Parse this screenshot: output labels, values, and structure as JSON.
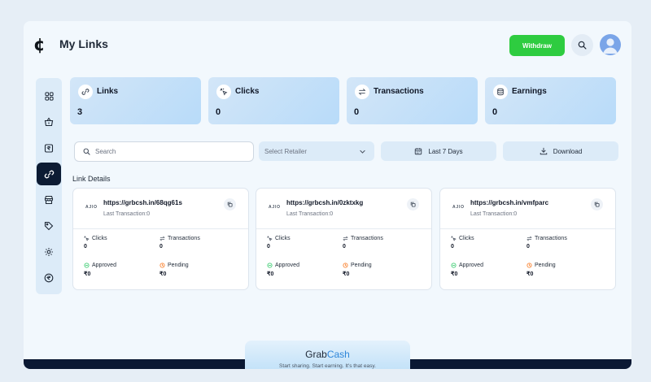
{
  "header": {
    "logo_glyph": "¢",
    "title": "My Links",
    "withdraw_label": "Withdraw"
  },
  "colors": {
    "accent_green": "#2ecc40",
    "navy": "#0c1b33",
    "pending_orange": "#f97316",
    "approved_green": "#22c55e",
    "link_blue": "#2f86d9"
  },
  "sidebar": {
    "items": [
      {
        "icon": "grid-icon"
      },
      {
        "icon": "basket-icon"
      },
      {
        "icon": "rupee-box-icon"
      },
      {
        "icon": "link-icon",
        "active": true
      },
      {
        "icon": "store-icon"
      },
      {
        "icon": "tag-icon"
      },
      {
        "icon": "gear-icon"
      },
      {
        "icon": "rupee-circle-icon"
      }
    ]
  },
  "stats": [
    {
      "label": "Links",
      "value": "3",
      "icon": "link-icon"
    },
    {
      "label": "Clicks",
      "value": "0",
      "icon": "click-icon"
    },
    {
      "label": "Transactions",
      "value": "0",
      "icon": "exchange-icon"
    },
    {
      "label": "Earnings",
      "value": "0",
      "icon": "coins-icon"
    }
  ],
  "filters": {
    "search_placeholder": "Search",
    "retailer_placeholder": "Select Retailer",
    "date_label": "Last 7 Days",
    "download_label": "Download"
  },
  "section_title": "Link Details",
  "cards": [
    {
      "retailer": "AJIO",
      "url": "https://grbcsh.in/68qg61s",
      "last_transaction": "Last Transaction:0",
      "clicks_label": "Clicks",
      "clicks": "0",
      "transactions_label": "Transactions",
      "transactions": "0",
      "approved_label": "Approved",
      "approved": "₹0",
      "pending_label": "Pending",
      "pending": "₹0"
    },
    {
      "retailer": "AJIO",
      "url": "https://grbcsh.in/0zktxkg",
      "last_transaction": "Last Transaction:0",
      "clicks_label": "Clicks",
      "clicks": "0",
      "transactions_label": "Transactions",
      "transactions": "0",
      "approved_label": "Approved",
      "approved": "₹0",
      "pending_label": "Pending",
      "pending": "₹0"
    },
    {
      "retailer": "AJIO",
      "url": "https://grbcsh.in/vmfparc",
      "last_transaction": "Last Transaction:0",
      "clicks_label": "Clicks",
      "clicks": "0",
      "transactions_label": "Transactions",
      "transactions": "0",
      "approved_label": "Approved",
      "approved": "₹0",
      "pending_label": "Pending",
      "pending": "₹0"
    }
  ],
  "promo": {
    "brand_part1": "Grab",
    "brand_part2": "Cash",
    "tagline": "Start sharing. Start earning. It's that easy."
  }
}
